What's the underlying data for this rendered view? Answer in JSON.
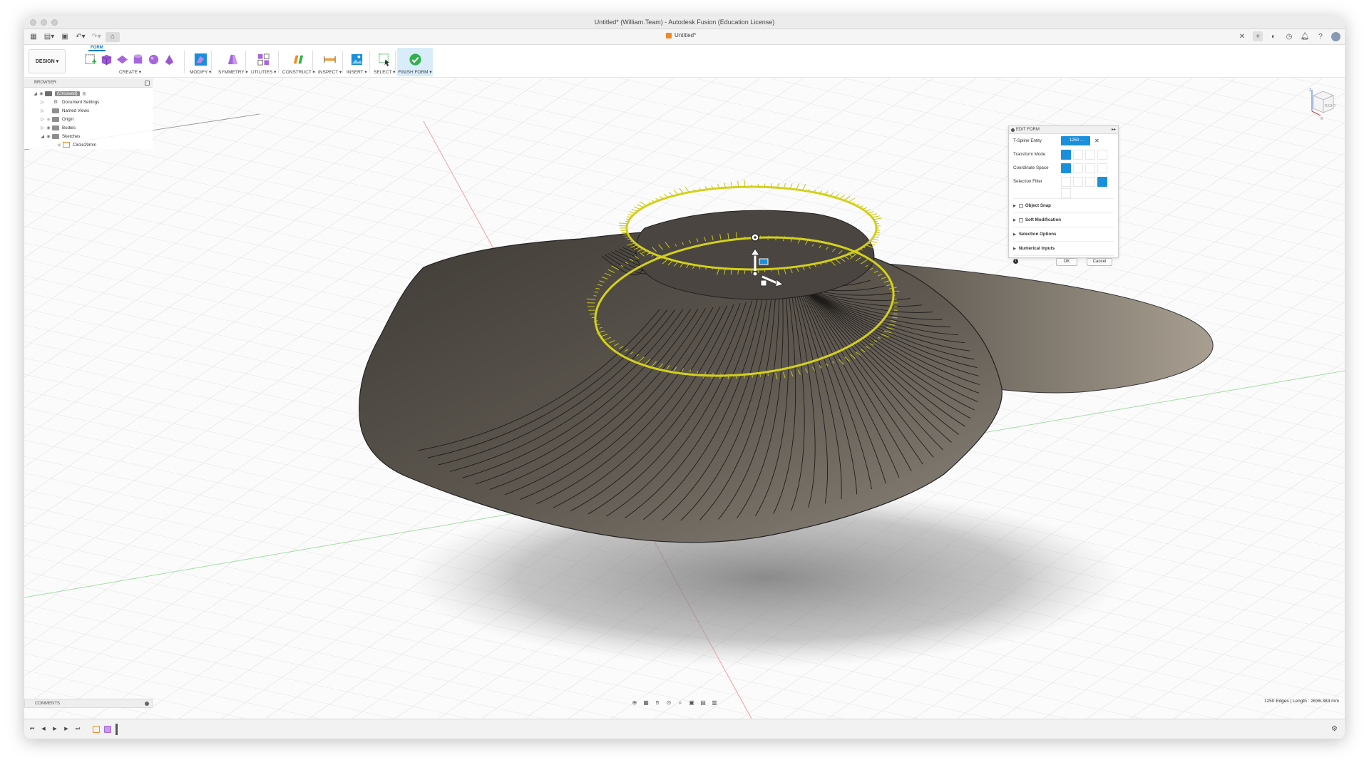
{
  "window": {
    "title": "Untitled* (William.Team) - Autodesk Fusion (Education License)"
  },
  "tabbar": {
    "doc_tab": "Untitled*",
    "icons": [
      "grid-icon",
      "file-icon",
      "save-icon",
      "undo-icon",
      "redo-icon",
      "home-icon",
      "close-icon",
      "plus-icon",
      "extensions-icon",
      "job-status-icon",
      "notifications-icon",
      "help-icon",
      "avatar-icon"
    ]
  },
  "toolbar": {
    "workspace": "DESIGN ▾",
    "active_tab": "FORM",
    "groups": [
      {
        "label": "CREATE ▾"
      },
      {
        "label": "MODIFY ▾"
      },
      {
        "label": "SYMMETRY ▾"
      },
      {
        "label": "UTILITIES ▾"
      },
      {
        "label": "CONSTRUCT ▾"
      },
      {
        "label": "INSPECT ▾"
      },
      {
        "label": "INSERT ▾"
      },
      {
        "label": "SELECT ▾"
      },
      {
        "label": "FINISH FORM ▾"
      }
    ]
  },
  "browser": {
    "title": "BROWSER",
    "items": [
      {
        "label": "(Unsaved)"
      },
      {
        "label": "Document Settings"
      },
      {
        "label": "Named Views"
      },
      {
        "label": "Origin"
      },
      {
        "label": "Bodies"
      },
      {
        "label": "Sketches"
      },
      {
        "label": "Circle29mm"
      }
    ]
  },
  "edit_form": {
    "title": "EDIT FORM",
    "rows": [
      {
        "label": "T-Spline Entity",
        "value": "1250 ..."
      },
      {
        "label": "Transform Mode"
      },
      {
        "label": "Coordinate Space"
      },
      {
        "label": "Selection Filter"
      }
    ],
    "sections": [
      "Object Snap",
      "Soft Modification",
      "Selection Options",
      "Numerical Inputs"
    ],
    "ok": "OK",
    "cancel": "Cancel"
  },
  "viewcube": {
    "face": "RIGHT",
    "axis_z": "Z",
    "axis_x": "X"
  },
  "comments": {
    "title": "COMMENTS"
  },
  "status": {
    "text": "1250 Edges | Length : 2636.383 mm"
  },
  "colors": {
    "accent": "#1a8fdc",
    "selection": "#d4d11a",
    "body": "#5e5850",
    "finish": "#2fb24a"
  }
}
